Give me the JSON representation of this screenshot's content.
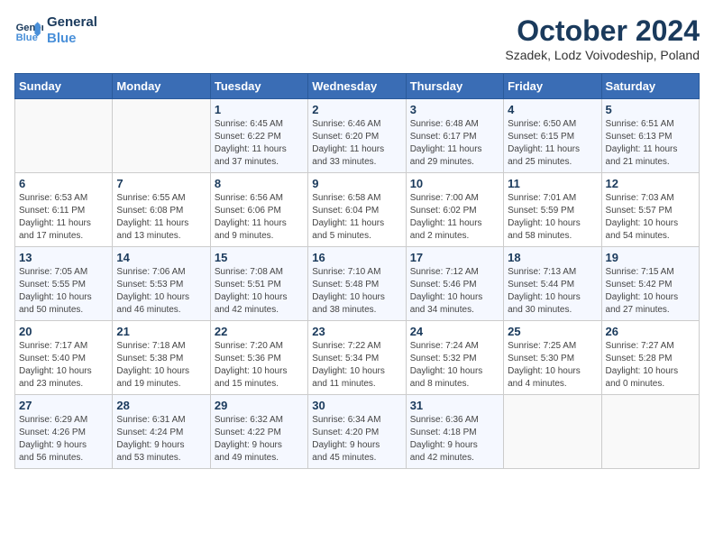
{
  "logo": {
    "line1": "General",
    "line2": "Blue"
  },
  "title": "October 2024",
  "subtitle": "Szadek, Lodz Voivodeship, Poland",
  "weekdays": [
    "Sunday",
    "Monday",
    "Tuesday",
    "Wednesday",
    "Thursday",
    "Friday",
    "Saturday"
  ],
  "weeks": [
    [
      {
        "num": "",
        "detail": ""
      },
      {
        "num": "",
        "detail": ""
      },
      {
        "num": "1",
        "detail": "Sunrise: 6:45 AM\nSunset: 6:22 PM\nDaylight: 11 hours\nand 37 minutes."
      },
      {
        "num": "2",
        "detail": "Sunrise: 6:46 AM\nSunset: 6:20 PM\nDaylight: 11 hours\nand 33 minutes."
      },
      {
        "num": "3",
        "detail": "Sunrise: 6:48 AM\nSunset: 6:17 PM\nDaylight: 11 hours\nand 29 minutes."
      },
      {
        "num": "4",
        "detail": "Sunrise: 6:50 AM\nSunset: 6:15 PM\nDaylight: 11 hours\nand 25 minutes."
      },
      {
        "num": "5",
        "detail": "Sunrise: 6:51 AM\nSunset: 6:13 PM\nDaylight: 11 hours\nand 21 minutes."
      }
    ],
    [
      {
        "num": "6",
        "detail": "Sunrise: 6:53 AM\nSunset: 6:11 PM\nDaylight: 11 hours\nand 17 minutes."
      },
      {
        "num": "7",
        "detail": "Sunrise: 6:55 AM\nSunset: 6:08 PM\nDaylight: 11 hours\nand 13 minutes."
      },
      {
        "num": "8",
        "detail": "Sunrise: 6:56 AM\nSunset: 6:06 PM\nDaylight: 11 hours\nand 9 minutes."
      },
      {
        "num": "9",
        "detail": "Sunrise: 6:58 AM\nSunset: 6:04 PM\nDaylight: 11 hours\nand 5 minutes."
      },
      {
        "num": "10",
        "detail": "Sunrise: 7:00 AM\nSunset: 6:02 PM\nDaylight: 11 hours\nand 2 minutes."
      },
      {
        "num": "11",
        "detail": "Sunrise: 7:01 AM\nSunset: 5:59 PM\nDaylight: 10 hours\nand 58 minutes."
      },
      {
        "num": "12",
        "detail": "Sunrise: 7:03 AM\nSunset: 5:57 PM\nDaylight: 10 hours\nand 54 minutes."
      }
    ],
    [
      {
        "num": "13",
        "detail": "Sunrise: 7:05 AM\nSunset: 5:55 PM\nDaylight: 10 hours\nand 50 minutes."
      },
      {
        "num": "14",
        "detail": "Sunrise: 7:06 AM\nSunset: 5:53 PM\nDaylight: 10 hours\nand 46 minutes."
      },
      {
        "num": "15",
        "detail": "Sunrise: 7:08 AM\nSunset: 5:51 PM\nDaylight: 10 hours\nand 42 minutes."
      },
      {
        "num": "16",
        "detail": "Sunrise: 7:10 AM\nSunset: 5:48 PM\nDaylight: 10 hours\nand 38 minutes."
      },
      {
        "num": "17",
        "detail": "Sunrise: 7:12 AM\nSunset: 5:46 PM\nDaylight: 10 hours\nand 34 minutes."
      },
      {
        "num": "18",
        "detail": "Sunrise: 7:13 AM\nSunset: 5:44 PM\nDaylight: 10 hours\nand 30 minutes."
      },
      {
        "num": "19",
        "detail": "Sunrise: 7:15 AM\nSunset: 5:42 PM\nDaylight: 10 hours\nand 27 minutes."
      }
    ],
    [
      {
        "num": "20",
        "detail": "Sunrise: 7:17 AM\nSunset: 5:40 PM\nDaylight: 10 hours\nand 23 minutes."
      },
      {
        "num": "21",
        "detail": "Sunrise: 7:18 AM\nSunset: 5:38 PM\nDaylight: 10 hours\nand 19 minutes."
      },
      {
        "num": "22",
        "detail": "Sunrise: 7:20 AM\nSunset: 5:36 PM\nDaylight: 10 hours\nand 15 minutes."
      },
      {
        "num": "23",
        "detail": "Sunrise: 7:22 AM\nSunset: 5:34 PM\nDaylight: 10 hours\nand 11 minutes."
      },
      {
        "num": "24",
        "detail": "Sunrise: 7:24 AM\nSunset: 5:32 PM\nDaylight: 10 hours\nand 8 minutes."
      },
      {
        "num": "25",
        "detail": "Sunrise: 7:25 AM\nSunset: 5:30 PM\nDaylight: 10 hours\nand 4 minutes."
      },
      {
        "num": "26",
        "detail": "Sunrise: 7:27 AM\nSunset: 5:28 PM\nDaylight: 10 hours\nand 0 minutes."
      }
    ],
    [
      {
        "num": "27",
        "detail": "Sunrise: 6:29 AM\nSunset: 4:26 PM\nDaylight: 9 hours\nand 56 minutes."
      },
      {
        "num": "28",
        "detail": "Sunrise: 6:31 AM\nSunset: 4:24 PM\nDaylight: 9 hours\nand 53 minutes."
      },
      {
        "num": "29",
        "detail": "Sunrise: 6:32 AM\nSunset: 4:22 PM\nDaylight: 9 hours\nand 49 minutes."
      },
      {
        "num": "30",
        "detail": "Sunrise: 6:34 AM\nSunset: 4:20 PM\nDaylight: 9 hours\nand 45 minutes."
      },
      {
        "num": "31",
        "detail": "Sunrise: 6:36 AM\nSunset: 4:18 PM\nDaylight: 9 hours\nand 42 minutes."
      },
      {
        "num": "",
        "detail": ""
      },
      {
        "num": "",
        "detail": ""
      }
    ]
  ]
}
